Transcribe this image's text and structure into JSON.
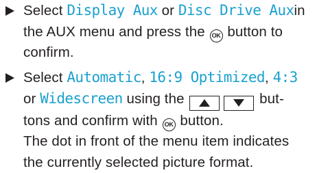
{
  "colors": {
    "text": "#231f20",
    "display_text": "#1aa0cf"
  },
  "icons": {
    "ok_button": "ok-button-icon",
    "up_button": "up-arrow-key-icon",
    "down_button": "down-arrow-key-icon",
    "bullet": "triangle-bullet-icon"
  },
  "step1": {
    "select": "Select",
    "option_a": "Display Aux",
    "or": "or",
    "option_b": "Disc Drive Aux",
    "text_in": "in",
    "text_menu": "the AUX menu and press the",
    "ok_label": "OK",
    "text_confirm": "button to",
    "text_end": "confirm."
  },
  "step2": {
    "select": "Select",
    "option_1": "Automatic",
    "comma1": ",",
    "option_2": "16:9 Optimized",
    "comma2": ",",
    "option_3": "4:3",
    "or": "or",
    "option_4": "Widescreen",
    "text_using": "using the",
    "text_but": "but-",
    "text_tons": "tons and confirm with",
    "ok_label": "OK",
    "text_button": "button.",
    "note_line1": "The dot in front of the menu item indicates",
    "note_line2": "the currently selected picture format."
  }
}
